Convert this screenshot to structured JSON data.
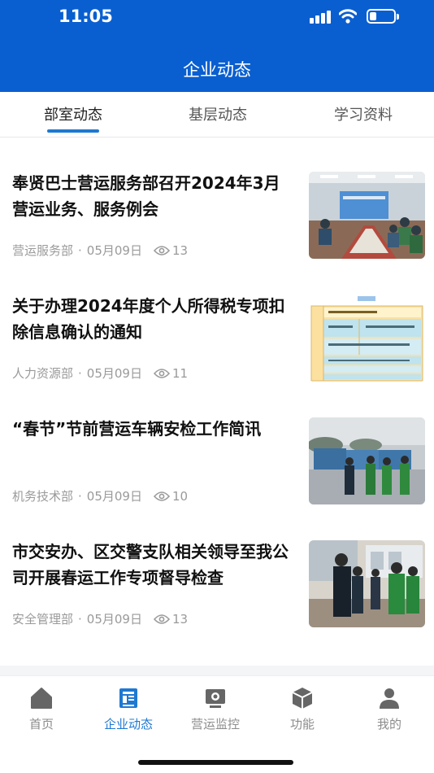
{
  "status_bar": {
    "time": "11:05"
  },
  "header": {
    "title": "企业动态"
  },
  "tabs": [
    {
      "label": "部室动态",
      "active": true
    },
    {
      "label": "基层动态",
      "active": false
    },
    {
      "label": "学习资料",
      "active": false
    }
  ],
  "articles": [
    {
      "title": "奉贤巴士营运服务部召开2024年3月营运业务、服务例会",
      "department": "营运服务部",
      "date": "05月09日",
      "views": "13",
      "thumbnail": "meeting-room-photo"
    },
    {
      "title": "关于办理2024年度个人所得税专项扣除信息确认的通知",
      "department": "人力资源部",
      "date": "05月09日",
      "views": "11",
      "thumbnail": "tax-form-document"
    },
    {
      "title": "“春节”节前营运车辆安检工作简讯",
      "department": "机务技术部",
      "date": "05月09日",
      "views": "10",
      "thumbnail": "bus-depot-inspection-photo"
    },
    {
      "title": "市交安办、区交警支队相关领导至我公司开展春运工作专项督导检查",
      "department": "安全管理部",
      "date": "05月09日",
      "views": "13",
      "thumbnail": "supervision-visit-photo"
    }
  ],
  "meta_separator": "·",
  "bottom_nav": [
    {
      "label": "首页",
      "icon": "home-icon",
      "active": false
    },
    {
      "label": "企业动态",
      "icon": "news-icon",
      "active": true
    },
    {
      "label": "营运监控",
      "icon": "monitor-icon",
      "active": false
    },
    {
      "label": "功能",
      "icon": "cube-icon",
      "active": false
    },
    {
      "label": "我的",
      "icon": "profile-icon",
      "active": false
    }
  ],
  "colors": {
    "header_bg": "#0a5fd0",
    "accent": "#1f78d1",
    "inactive": "#8c8c8c"
  }
}
